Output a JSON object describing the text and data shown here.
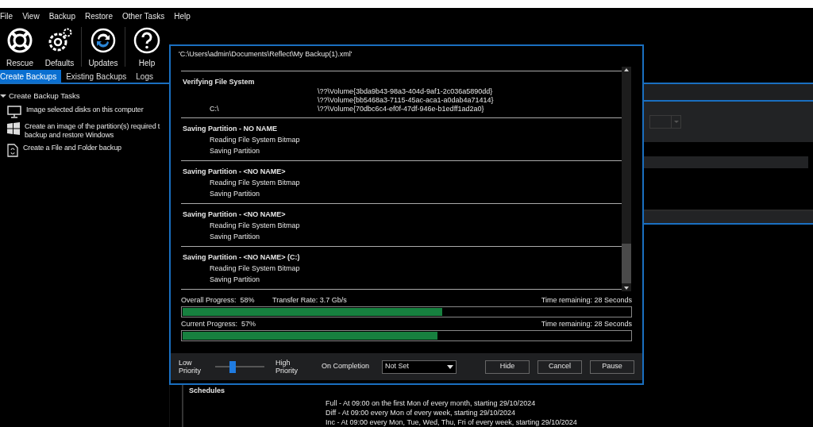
{
  "menu": [
    "File",
    "View",
    "Backup",
    "Restore",
    "Other Tasks",
    "Help"
  ],
  "toolbar": [
    {
      "kind": "rescue",
      "label": "Rescue"
    },
    {
      "kind": "defaults",
      "label": "Defaults"
    },
    {
      "kind": "updates",
      "label": "Updates"
    },
    {
      "kind": "help",
      "label": "Help"
    }
  ],
  "tabs": [
    {
      "label": "Create Backups",
      "selected": true
    },
    {
      "label": "Existing Backups",
      "selected": false
    },
    {
      "label": "Logs",
      "selected": false
    }
  ],
  "tree": {
    "title": "Create Backup Tasks",
    "expanded": true,
    "items": [
      {
        "kind": "monitor",
        "lines": [
          "Image selected disks on this computer"
        ]
      },
      {
        "kind": "windows",
        "lines": [
          "Create an image of the partition(s) required t",
          "backup and restore Windows"
        ]
      },
      {
        "kind": "file",
        "lines": [
          "Create a File and Folder backup"
        ]
      }
    ]
  },
  "dialog": {
    "path": "'C:\\Users\\admin\\Documents\\Reflect\\My Backup(1).xml'",
    "log": [
      {
        "title": "Verifying File System",
        "rows": [
          {
            "left": "",
            "right": "\\??\\Volume{3bda9b43-98a3-404d-9af1-2c036a5890dd}"
          },
          {
            "left": "",
            "right": "\\??\\Volume{bb5468a3-7115-45ac-aca1-a0dab4a71414}"
          },
          {
            "left": "C:\\",
            "right": "\\??\\Volume{70dbc6c4-ef0f-47df-946e-b1edff1ad2a0}"
          }
        ]
      },
      {
        "title": "Saving Partition - NO NAME",
        "rows": [
          {
            "left": "Reading File System Bitmap",
            "right": ""
          },
          {
            "left": "Saving Partition",
            "right": ""
          }
        ]
      },
      {
        "title": "Saving Partition - <NO NAME>",
        "rows": [
          {
            "left": "Reading File System Bitmap",
            "right": ""
          },
          {
            "left": "Saving Partition",
            "right": ""
          }
        ]
      },
      {
        "title": "Saving Partition - <NO NAME>",
        "rows": [
          {
            "left": "Reading File System Bitmap",
            "right": ""
          },
          {
            "left": "Saving Partition",
            "right": ""
          }
        ]
      },
      {
        "title": "Saving Partition - <NO NAME> (C:)",
        "rows": [
          {
            "left": "Reading File System Bitmap",
            "right": ""
          },
          {
            "left": "Saving Partition",
            "right": ""
          }
        ]
      }
    ],
    "progress": [
      {
        "label": "Overall Progress:",
        "value": "58%",
        "rate": "Transfer Rate: 3.7 Gb/s",
        "remaining": "Time remaining: 28 Seconds",
        "level": 0.58
      },
      {
        "label": "Current Progress:",
        "value": "57%",
        "remaining": "Time remaining: 28 Seconds",
        "level": 0.57
      }
    ],
    "priority": {
      "low": [
        "Low",
        "Priority"
      ],
      "high": [
        "High",
        "Priority"
      ],
      "level": 0.35
    },
    "on_completion": {
      "label": "On Completion",
      "value": "Not Set"
    },
    "buttons": [
      "Hide",
      "Cancel",
      "Pause"
    ]
  },
  "schedules": {
    "title": "Schedules",
    "lines": [
      "Full - At 09:00 on the first Mon of every month, starting 29/10/2024",
      "Diff - At 09:00 every Mon of every week, starting 29/10/2024",
      "Inc - At 09:00 every Mon, Tue, Wed, Thu, Fri of every week, starting 29/10/2024"
    ]
  }
}
